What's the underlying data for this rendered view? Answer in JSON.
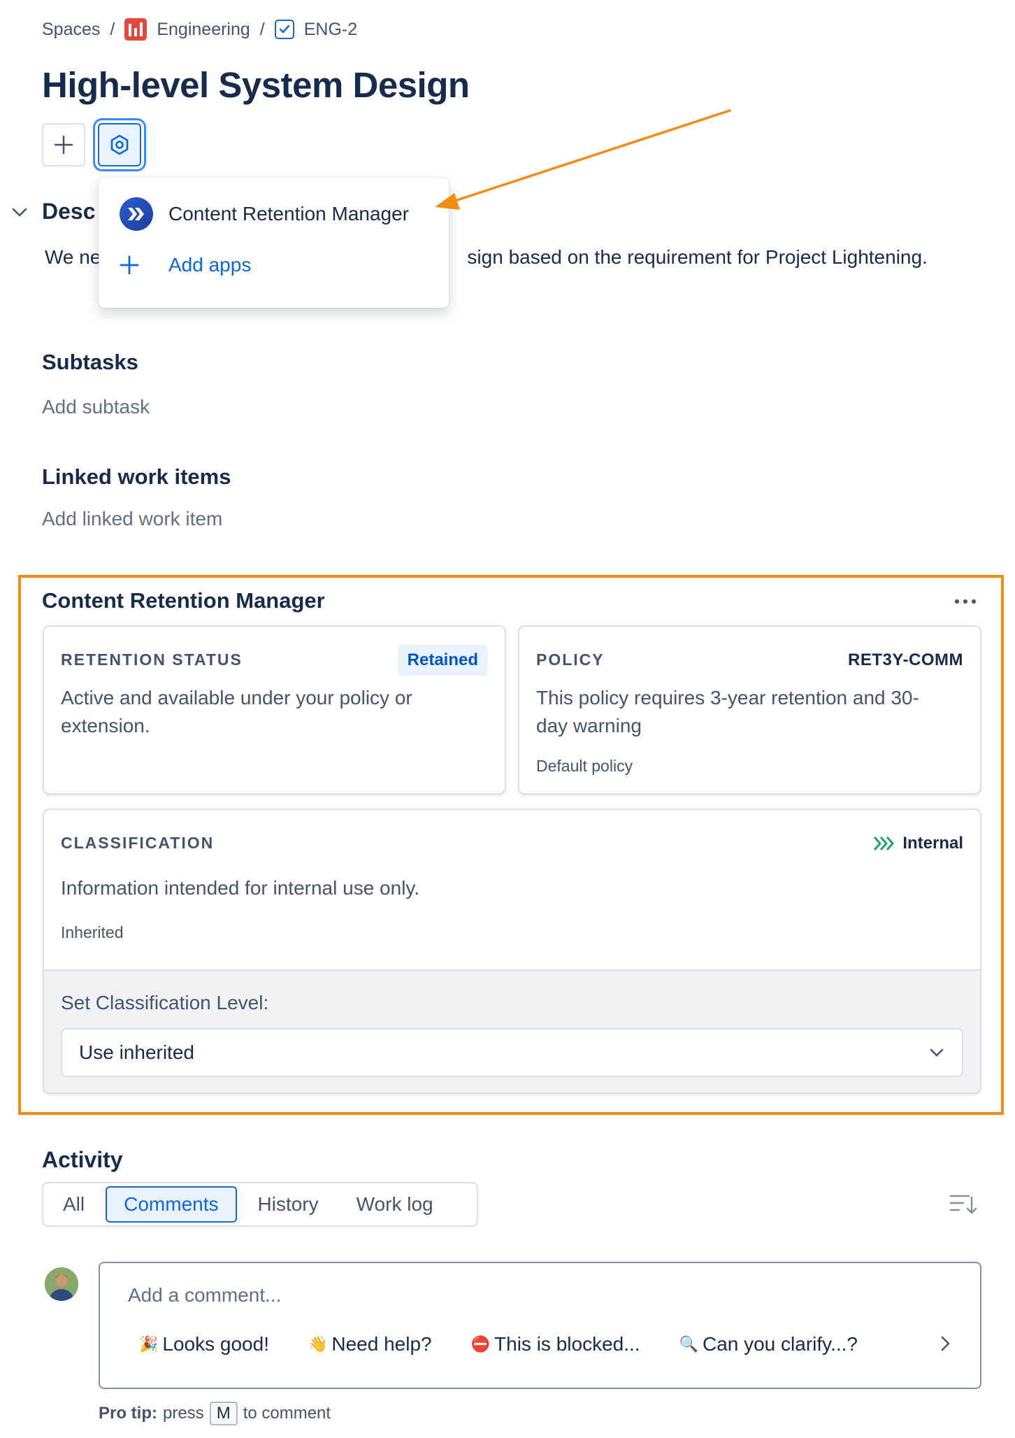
{
  "breadcrumb": {
    "spaces": "Spaces",
    "separator": "/",
    "project": "Engineering",
    "issue_key": "ENG-2"
  },
  "page_title": "High-level System Design",
  "apps_menu": {
    "items": [
      {
        "label": "Content Retention Manager",
        "icon": "content-retention-logo-icon"
      },
      {
        "label": "Add apps",
        "icon": "plus-icon"
      }
    ]
  },
  "description": {
    "heading": "Desc",
    "text_start": "We ne",
    "text_end": "sign based on the requirement for Project Lightening."
  },
  "subtasks": {
    "heading": "Subtasks",
    "add_label": "Add subtask"
  },
  "linked": {
    "heading": "Linked work items",
    "add_label": "Add linked work item"
  },
  "crm_panel": {
    "title": "Content Retention Manager",
    "retention": {
      "label": "RETENTION STATUS",
      "badge": "Retained",
      "body": [
        "Active and available under your policy or",
        "extension."
      ]
    },
    "policy": {
      "label": "POLICY",
      "code": "RET3Y-COMM",
      "body": [
        "This policy requires 3-year retention and 30-",
        "day warning"
      ],
      "meta": "Default policy"
    },
    "classification": {
      "label": "CLASSIFICATION",
      "level": "Internal",
      "body": "Information intended for internal use only.",
      "meta": "Inherited",
      "set_label": "Set Classification Level:",
      "select_value": "Use inherited"
    }
  },
  "activity": {
    "heading": "Activity",
    "tabs": [
      "All",
      "Comments",
      "History",
      "Work log"
    ],
    "active_tab": "Comments",
    "comment_placeholder": "Add a comment...",
    "quick_replies": [
      {
        "emoji": "🎉",
        "text": "Looks good!"
      },
      {
        "emoji": "👋",
        "text": "Need help?"
      },
      {
        "emoji": "⛔",
        "text": "This is blocked..."
      },
      {
        "emoji": "🔍",
        "text": "Can you clarify...?"
      }
    ],
    "protip": {
      "prefix": "Pro tip:",
      "press": "press",
      "key": "M",
      "suffix": "to comment"
    }
  },
  "colors": {
    "primary": "#1868db",
    "link": "#0c66e4",
    "highlight": "#f18d13",
    "internal_green": "#22a06b",
    "engineering_red": "#e2483d"
  }
}
